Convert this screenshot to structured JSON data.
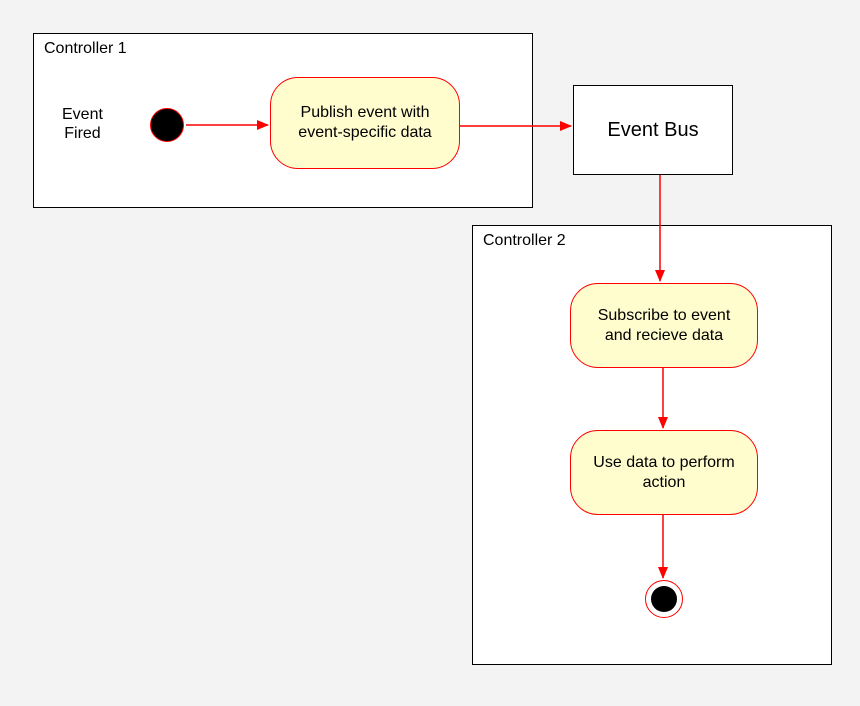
{
  "controller1": {
    "title": "Controller 1",
    "eventFiredLine1": "Event",
    "eventFiredLine2": "Fired",
    "publish": "Publish event with event-specific data"
  },
  "eventBus": {
    "label": "Event Bus"
  },
  "controller2": {
    "title": "Controller 2",
    "subscribe": "Subscribe to event and recieve data",
    "useData": "Use data to perform action"
  },
  "colors": {
    "arrow": "#ff0000"
  }
}
